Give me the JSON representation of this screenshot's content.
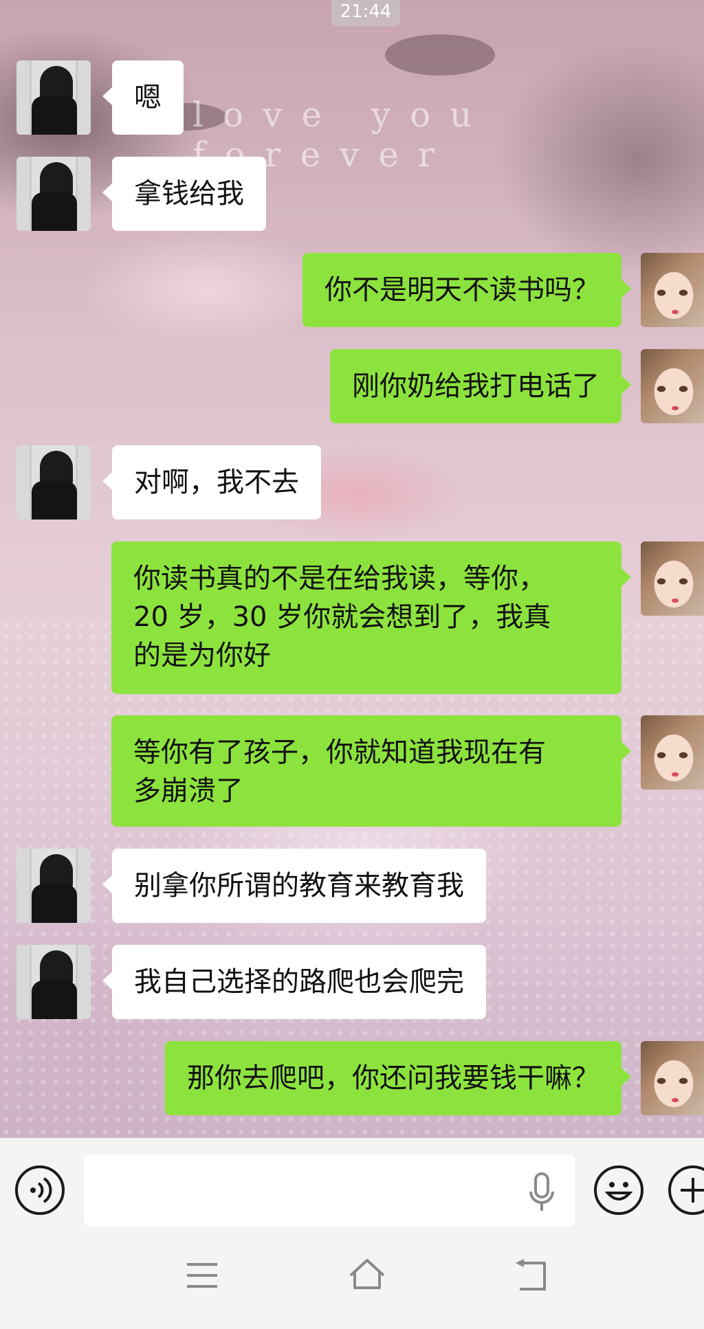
{
  "status": {
    "time": "21:44"
  },
  "wallpaper": {
    "caption": "love you forever"
  },
  "messages": [
    {
      "side": "in",
      "lines": [
        "嗯"
      ]
    },
    {
      "side": "in",
      "lines": [
        "拿钱给我"
      ]
    },
    {
      "side": "out",
      "lines": [
        "你不是明天不读书吗？"
      ]
    },
    {
      "side": "out",
      "lines": [
        "刚你奶给我打电话了"
      ]
    },
    {
      "side": "in",
      "lines": [
        "对啊，我不去"
      ]
    },
    {
      "side": "out",
      "lines": [
        "你读书真的不是在给我读，等你，",
        "20 岁，30 岁你就会想到了，我真",
        "的是为你好"
      ]
    },
    {
      "side": "out",
      "lines": [
        "等你有了孩子，你就知道我现在有",
        "多崩溃了"
      ]
    },
    {
      "side": "in",
      "lines": [
        "别拿你所谓的教育来教育我"
      ]
    },
    {
      "side": "in",
      "lines": [
        "我自己选择的路爬也会爬完"
      ]
    },
    {
      "side": "out",
      "lines": [
        "那你去爬吧，你还问我要钱干嘛？"
      ]
    }
  ],
  "input_bar": {
    "text_value": "",
    "voice_toggle_icon": "voice-wave-icon",
    "mic_icon": "microphone-icon",
    "emoji_icon": "smiley-icon",
    "more_icon": "plus-icon"
  },
  "nav_bar": {
    "menu_icon": "menu-lines-icon",
    "home_icon": "home-icon",
    "back_icon": "back-arrow-icon"
  },
  "colors": {
    "incoming_bubble": "#ffffff",
    "outgoing_bubble": "#8de33e",
    "input_bar_bg": "#f4f4f4"
  }
}
